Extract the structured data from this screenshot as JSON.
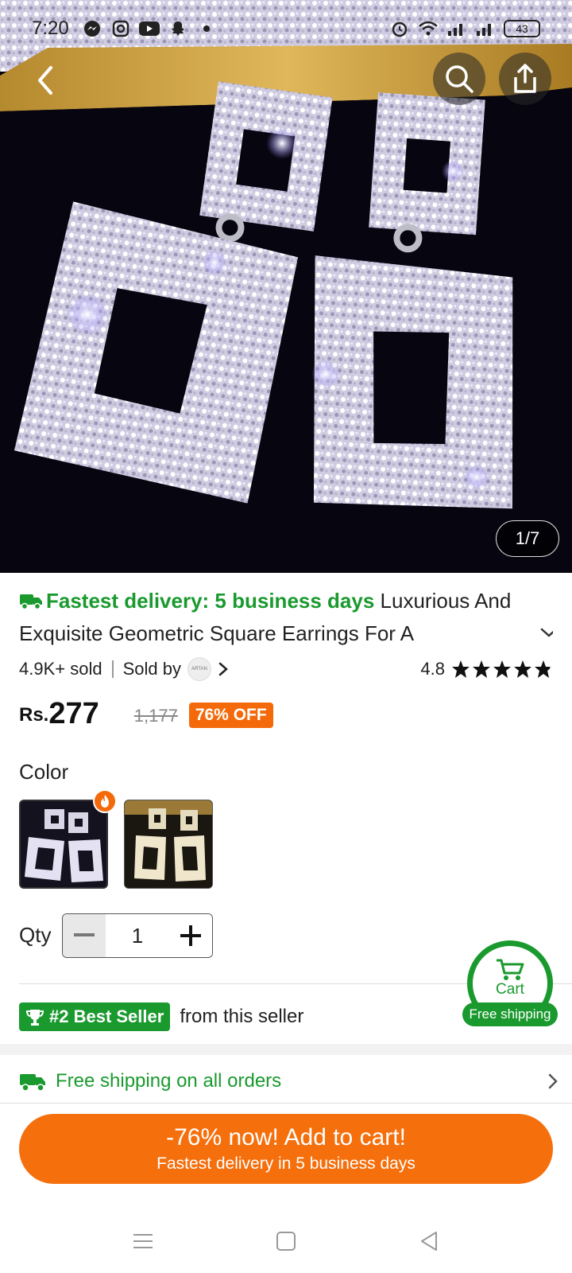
{
  "status_bar": {
    "time": "7:20",
    "battery": "43",
    "left_icons": [
      "messenger-icon",
      "instagram-icon",
      "youtube-icon",
      "snapchat-icon",
      "dot-icon"
    ],
    "right_icons": [
      "alarm-icon",
      "wifi-icon",
      "signal-icon",
      "signal-icon"
    ]
  },
  "header": {
    "back_icon": "chevron-left-icon",
    "search_icon": "search-icon",
    "share_icon": "share-icon"
  },
  "gallery": {
    "counter": "1/7"
  },
  "product": {
    "delivery_badge": "Fastest delivery: 5 business days",
    "title": "Luxurious And Exquisite Geometric Square Earrings For A",
    "sold": "4.9K+ sold",
    "sold_by": "Sold by",
    "seller_logo_text": "ARTAN",
    "rating": "4.8",
    "stars": 4.8,
    "currency": "Rs.",
    "price": "277",
    "old_price": "1,177",
    "discount": "76% OFF"
  },
  "options": {
    "color_label": "Color",
    "qty_label": "Qty",
    "qty_value": "1"
  },
  "best_seller": {
    "badge": "#2 Best Seller",
    "suffix": "from this seller"
  },
  "floating_cart": {
    "label": "Cart",
    "pill": "Free shipping"
  },
  "shipping": {
    "text": "Free shipping on all orders"
  },
  "cta": {
    "main": "-76% now! Add to cart!",
    "sub": "Fastest delivery in 5 business days"
  },
  "colors": {
    "accent_orange": "#f56f0c",
    "accent_green": "#1a9a2e"
  }
}
